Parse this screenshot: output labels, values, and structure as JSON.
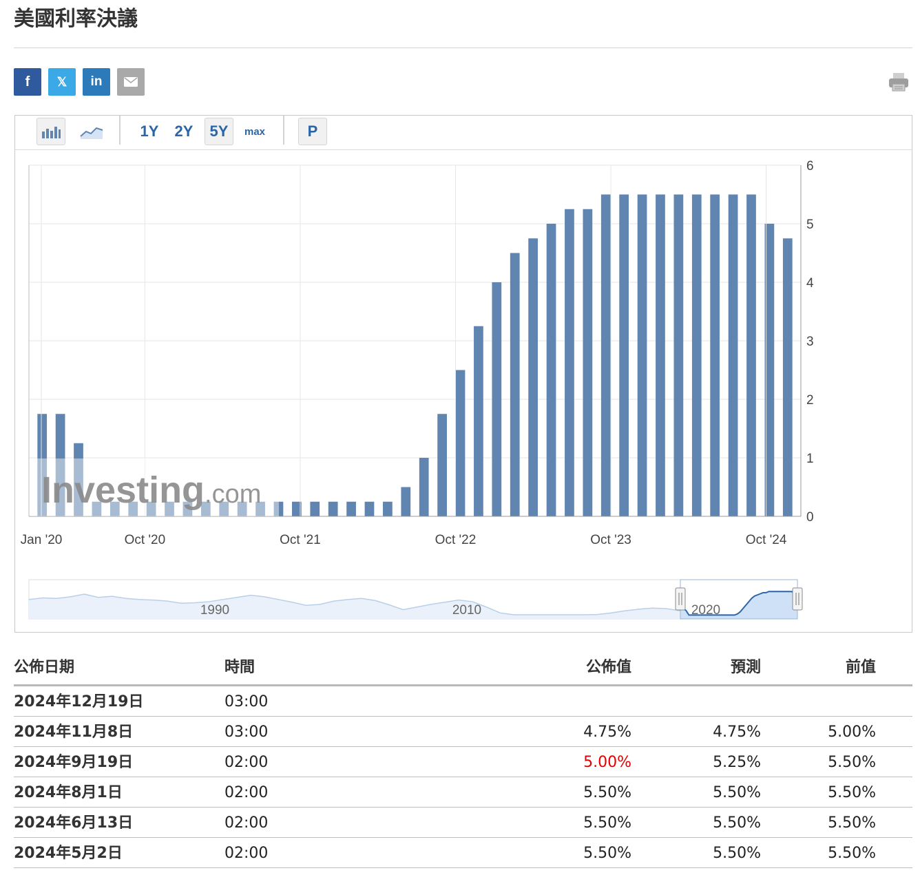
{
  "page": {
    "title": "美國利率決議"
  },
  "share": {
    "facebook": "f",
    "twitter": "𝕏",
    "linkedin": "in",
    "email_icon": "envelope-icon"
  },
  "toolbar": {
    "bar_icon": "bar-chart-icon",
    "line_icon": "line-chart-icon",
    "ranges": [
      "1Y",
      "2Y",
      "5Y",
      "max"
    ],
    "active_range": "5Y",
    "p_label": "P"
  },
  "colors": {
    "bar": "#5f85b0",
    "grid": "#e6e6e6",
    "accent_blue": "#2a65a8",
    "red": "#e60000",
    "navigator_fill": "#cfe1f7",
    "navigator_line": "#2a65a8"
  },
  "chart_data": {
    "type": "bar",
    "yticks": [
      0,
      1,
      2,
      3,
      4,
      5,
      6
    ],
    "ylim": [
      0,
      6
    ],
    "xtick_labels": [
      "Jan '20",
      "Oct '20",
      "Oct '21",
      "Oct '22",
      "Oct '23",
      "Oct '24"
    ],
    "watermark": "Investing.com",
    "values": [
      1.75,
      1.75,
      1.25,
      0.25,
      0.25,
      0.25,
      0.25,
      0.25,
      0.25,
      0.25,
      0.25,
      0.25,
      0.25,
      0.25,
      0.25,
      0.25,
      0.25,
      0.25,
      0.25,
      0.25,
      0.5,
      1.0,
      1.75,
      2.5,
      3.25,
      4.0,
      4.5,
      4.75,
      5.0,
      5.25,
      5.25,
      5.5,
      5.5,
      5.5,
      5.5,
      5.5,
      5.5,
      5.5,
      5.5,
      5.5,
      5.0,
      4.75
    ],
    "navigator_labels": [
      "1990",
      "2010",
      "2020"
    ]
  },
  "table": {
    "headers": {
      "date": "公佈日期",
      "time": "時間",
      "actual": "公佈值",
      "forecast": "預測",
      "previous": "前值"
    },
    "rows": [
      {
        "date": "2024年12月19日",
        "time": "03:00",
        "actual": "",
        "forecast": "",
        "previous": ""
      },
      {
        "date": "2024年11月8日",
        "time": "03:00",
        "actual": "4.75%",
        "forecast": "4.75%",
        "previous": "5.00%"
      },
      {
        "date": "2024年9月19日",
        "time": "02:00",
        "actual": "5.00%",
        "forecast": "5.25%",
        "previous": "5.50%",
        "actual_color": "#e60000"
      },
      {
        "date": "2024年8月1日",
        "time": "02:00",
        "actual": "5.50%",
        "forecast": "5.50%",
        "previous": "5.50%"
      },
      {
        "date": "2024年6月13日",
        "time": "02:00",
        "actual": "5.50%",
        "forecast": "5.50%",
        "previous": "5.50%"
      },
      {
        "date": "2024年5月2日",
        "time": "02:00",
        "actual": "5.50%",
        "forecast": "5.50%",
        "previous": "5.50%"
      }
    ]
  }
}
